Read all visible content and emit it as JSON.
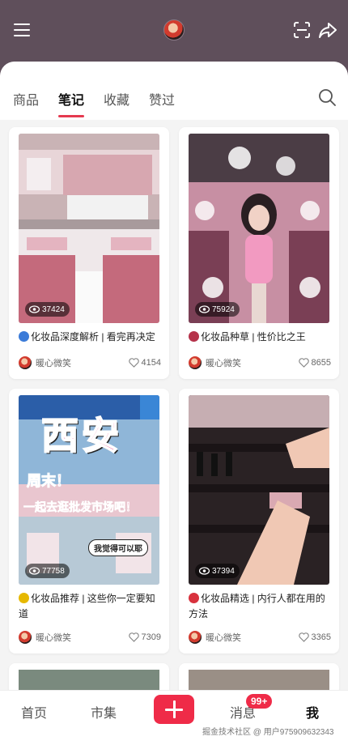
{
  "tabs": [
    "商品",
    "笔记",
    "收藏",
    "赞过"
  ],
  "active_tab": "笔记",
  "notes": [
    {
      "title": "化妆品深度解析 | 看完再决定",
      "emoji_icon": "magnifier-icon",
      "author": "暖心微笑",
      "views": "37424",
      "likes": "4154"
    },
    {
      "title": "化妆品种草 | 性价比之王",
      "emoji_icon": "flower-icon",
      "author": "暖心微笑",
      "views": "75924",
      "likes": "8655"
    },
    {
      "title": "化妆品推荐 | 这些你一定要知道",
      "emoji_icon": "sparkle-icon",
      "author": "暖心微笑",
      "views": "77758",
      "likes": "7309",
      "image_text": {
        "big": "西安",
        "line1": "周末！",
        "line2": "一起去逛批发市场吧！",
        "bubble": "我觉得可以耶"
      }
    },
    {
      "title": "化妆品精选 | 内行人都在用的方法",
      "emoji_icon": "target-icon",
      "author": "暖心微笑",
      "views": "37394",
      "likes": "3365"
    }
  ],
  "bottom_nav": {
    "home": "首页",
    "market": "市集",
    "messages": "消息",
    "me": "我",
    "badge": "99+"
  },
  "watermark": "掘金技术社区 @ 用户975909632343",
  "colors": {
    "accent": "#ef2b48",
    "header": "#5f4f5b"
  }
}
